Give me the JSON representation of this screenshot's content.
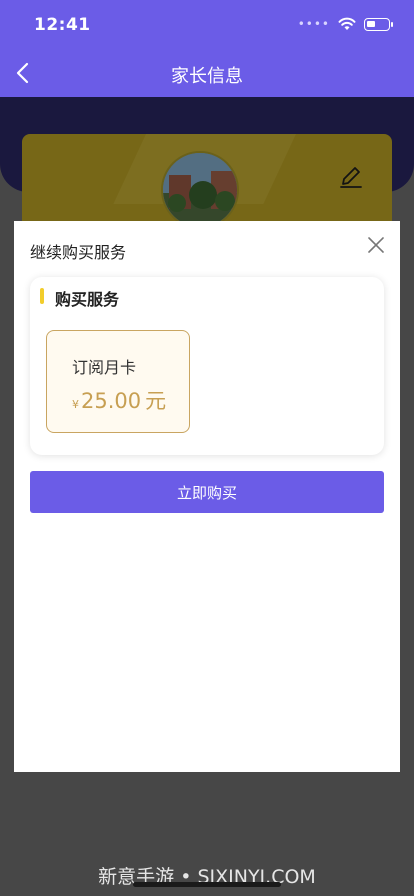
{
  "status_bar": {
    "time": "12:41",
    "signal_dots": "••••"
  },
  "nav": {
    "title": "家长信息",
    "back_icon": "chevron-left-icon"
  },
  "profile_card": {
    "edit_icon": "pencil-icon"
  },
  "modal": {
    "title": "继续购买服务",
    "close_icon": "close-icon",
    "section_title": "购买服务",
    "plans": [
      {
        "name": "订阅月卡",
        "currency": "¥",
        "price": "25.00",
        "unit": "元",
        "selected": true
      }
    ],
    "buy_label": "立即购买"
  },
  "watermark": "新意手游 • SJXINYI.COM",
  "colors": {
    "brand": "#6b5ce7",
    "accent_yellow": "#f2cd2b",
    "price_gold": "#c79f52"
  }
}
